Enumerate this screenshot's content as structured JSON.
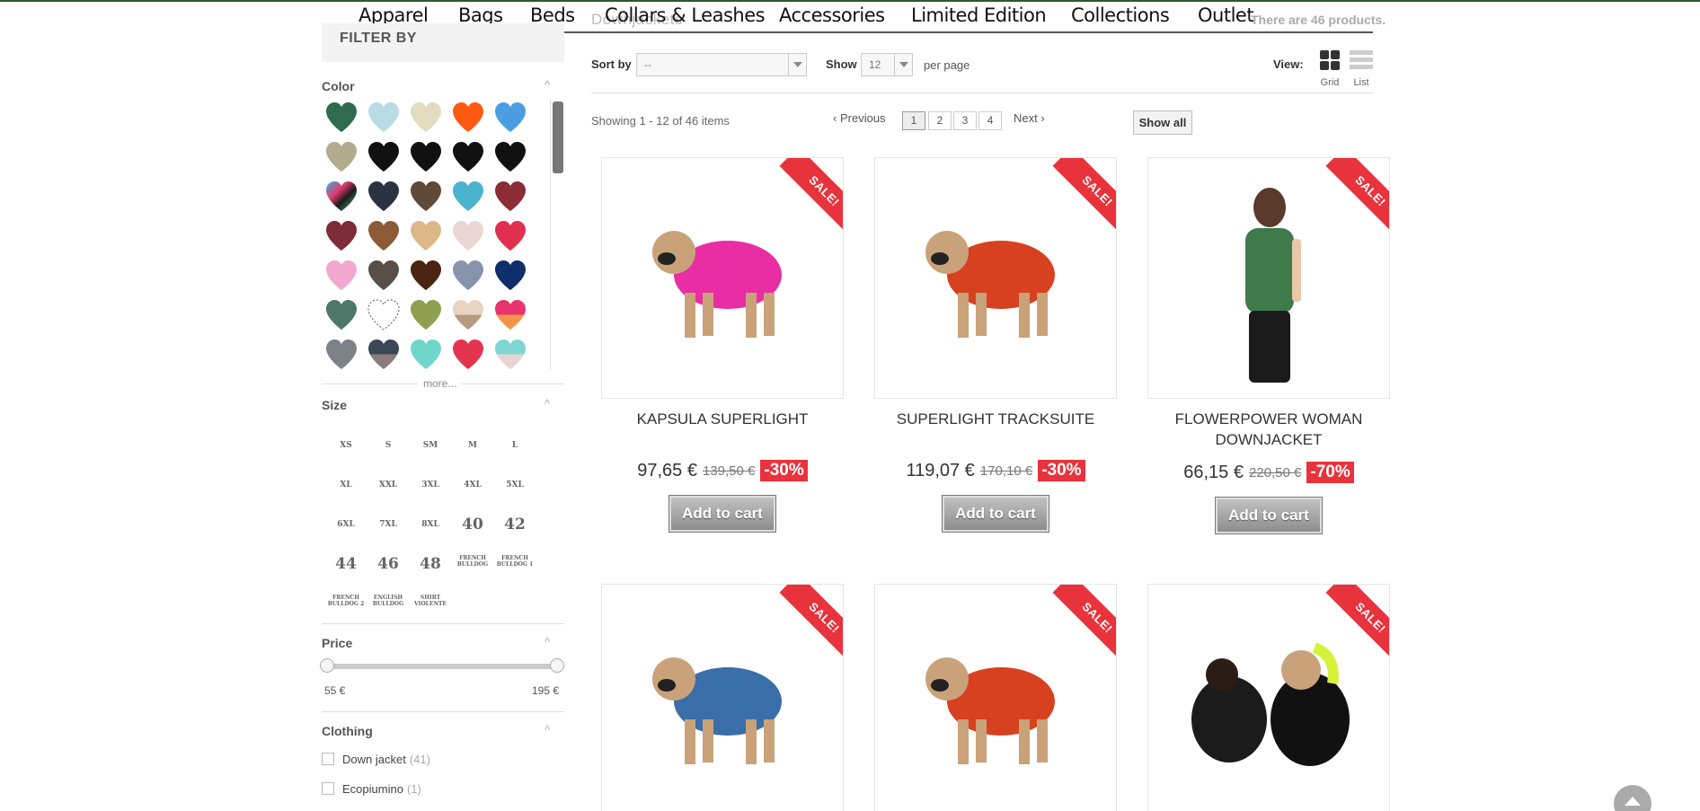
{
  "nav": {
    "items": [
      "Apparel",
      "Bags",
      "Beds",
      "Collars & Leashes",
      "Accessories",
      "Limited Edition",
      "Collections",
      "Outlet"
    ],
    "category_title": "Downjackets",
    "product_count": "There are 46 products."
  },
  "sidebar": {
    "filter_title": "FILTER BY",
    "color": {
      "title": "Color",
      "swatches": [
        [
          "#2f6b4f",
          "#b8dbe6",
          "#e3dcc1",
          "#ff5a12",
          "#4a9ee0"
        ],
        [
          "#b2ab90",
          "#111111",
          "#111111",
          "#111111",
          "#111111"
        ],
        [
          "multi",
          "#2c3340",
          "#5e4a37",
          "#4ab4cf",
          "#8c2c35"
        ],
        [
          "#7e2b38",
          "#8c5a37",
          "#dcb889",
          "#ead7d3",
          "#e0304f"
        ],
        [
          "#f2a8ce",
          "#5a4f48",
          "#4a2410",
          "#8793ad",
          "#0f2f6b"
        ],
        [
          "#4d7769",
          "dotted",
          "#8ea04e",
          "split-beige",
          "split-pink"
        ],
        [
          "#7c8287",
          "split-navy",
          "#6fd7ca",
          "#e3344e",
          "split-teal"
        ]
      ],
      "more_label": "more..."
    },
    "size": {
      "title": "Size",
      "rows": [
        [
          "XS",
          "S",
          "SM",
          "M",
          "L"
        ],
        [
          "XL",
          "XXL",
          "3XL",
          "4XL",
          "5XL"
        ],
        [
          "6XL",
          "7XL",
          "8XL",
          "40",
          "42"
        ],
        [
          "44",
          "46",
          "48",
          "FRENCH BULLDOG",
          "FRENCH BULLDOG 1"
        ],
        [
          "FRENCH BULLDOG 2",
          "ENGLISH BULLDOG",
          "SHIRT VIOLENTE"
        ]
      ]
    },
    "price": {
      "title": "Price",
      "min_label": "55 €",
      "max_label": "195 €"
    },
    "clothing": {
      "title": "Clothing",
      "options": [
        {
          "label": "Down jacket",
          "count": "(41)"
        },
        {
          "label": "Ecopiumino",
          "count": "(1)"
        }
      ]
    }
  },
  "toolbar": {
    "sort_label": "Sort by",
    "sort_value": "--",
    "show_label": "Show",
    "show_value": "12",
    "per_page": "per page",
    "view_label": "View:",
    "grid_label": "Grid",
    "list_label": "List"
  },
  "pagination": {
    "showing": "Showing 1 - 12 of 46 items",
    "previous": "Previous",
    "pages": [
      "1",
      "2",
      "3",
      "4"
    ],
    "next": "Next",
    "show_all": "Show all"
  },
  "products": [
    {
      "name": "KAPSULA SUPERLIGHT",
      "price": "97,65 €",
      "old_price": "139,50 €",
      "discount": "-30%",
      "badge": "SALE!",
      "cart": "Add to cart",
      "color": "#e82ea2"
    },
    {
      "name": "SUPERLIGHT TRACKSUITE",
      "price": "119,07 €",
      "old_price": "170,10 €",
      "discount": "-30%",
      "badge": "SALE!",
      "cart": "Add to cart",
      "color": "#d8411f"
    },
    {
      "name": "FLOWERPOWER WOMAN DOWNJACKET",
      "price": "66,15 €",
      "old_price": "220,50 €",
      "discount": "-70%",
      "badge": "SALE!",
      "cart": "Add to cart",
      "color": "#3f7a4a"
    },
    {
      "name": "",
      "price": "",
      "old_price": "",
      "discount": "",
      "badge": "SALE!",
      "cart": "",
      "color": "#3a6ea8"
    },
    {
      "name": "",
      "price": "",
      "old_price": "",
      "discount": "",
      "badge": "SALE!",
      "cart": "",
      "color": "#d8411f"
    },
    {
      "name": "",
      "price": "",
      "old_price": "",
      "discount": "",
      "badge": "SALE!",
      "cart": "",
      "color": "#111111"
    }
  ]
}
